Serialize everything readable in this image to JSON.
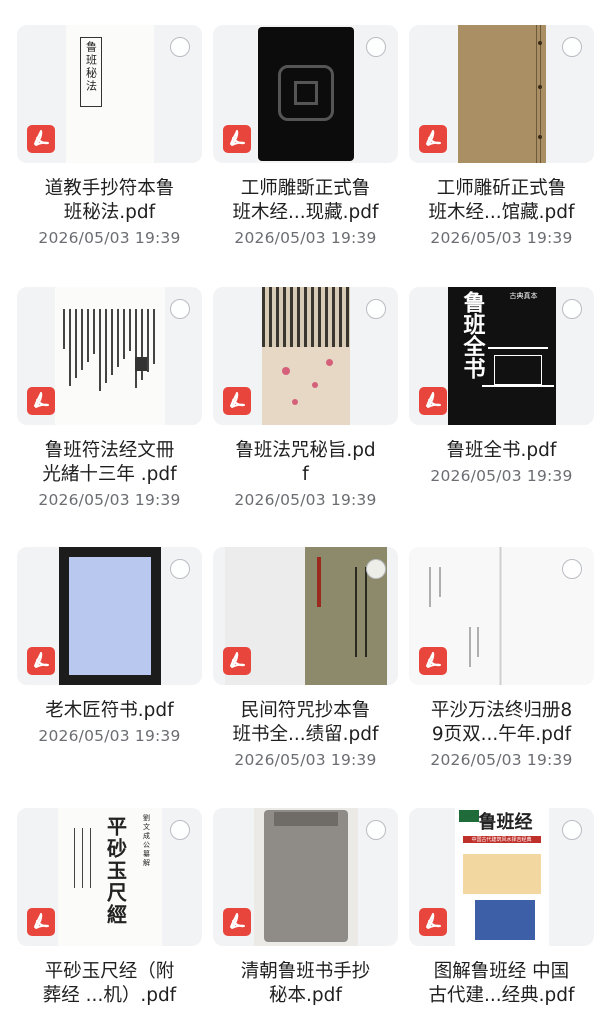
{
  "files": [
    {
      "name_lines": [
        "道教手抄符本鲁",
        "班秘法.pdf"
      ],
      "date": "2026/05/03 19:39",
      "thumb": "scroll-title",
      "thumb_text": "鲁班秘法"
    },
    {
      "name_lines": [
        "工师雕斲正式鲁",
        "班木经...现藏.pdf"
      ],
      "date": "2026/05/03 19:39",
      "thumb": "dark-seal"
    },
    {
      "name_lines": [
        "工师雕斫正式鲁",
        "班木经...馆藏.pdf"
      ],
      "date": "2026/05/03 19:39",
      "thumb": "brown-cover"
    },
    {
      "name_lines": [
        "鲁班符法经文冊",
        "光緒十三年 .pdf"
      ],
      "date": "2026/05/03 19:39",
      "thumb": "text-page"
    },
    {
      "name_lines": [
        "鲁班法咒秘旨.pd",
        "f"
      ],
      "date": "2026/05/03 19:39",
      "thumb": "worn-pages"
    },
    {
      "name_lines": [
        "鲁班全书.pdf"
      ],
      "date": "2026/05/03 19:39",
      "thumb": "black-cover",
      "thumb_text": "鲁班全书",
      "thumb_tag": "古典真本"
    },
    {
      "name_lines": [
        "老木匠符书.pdf"
      ],
      "date": "2026/05/03 19:39",
      "thumb": "blue-scan"
    },
    {
      "name_lines": [
        "民间符咒抄本鲁",
        "班书全...绩留.pdf"
      ],
      "date": "2026/05/03 19:39",
      "thumb": "open-book"
    },
    {
      "name_lines": [
        "平沙万法终归册8",
        "9页双...午年.pdf"
      ],
      "date": "2026/05/03 19:39",
      "thumb": "white-spread"
    },
    {
      "name_lines": [
        "平砂玉尺经（附",
        "葬经 ...机）.pdf"
      ],
      "date": "",
      "thumb": "title-page",
      "thumb_text": "平砂玉尺經",
      "thumb_tag": "劉文成公纂解"
    },
    {
      "name_lines": [
        "清朝鲁班书手抄",
        "秘本.pdf"
      ],
      "date": "",
      "thumb": "grey-book"
    },
    {
      "name_lines": [
        "图解鲁班经  中国",
        "古代建...经典.pdf"
      ],
      "date": "",
      "thumb": "color-cover",
      "thumb_text": "鲁班经",
      "thumb_tag": "中国古代建筑风水择吉经典"
    }
  ],
  "colors": {
    "pdf_red": "#e8453c",
    "date_grey": "#6b6d72",
    "tile_bg": "#f2f3f5"
  },
  "icons": {
    "file_type": "pdf-icon",
    "select": "checkbox-circle-icon"
  }
}
